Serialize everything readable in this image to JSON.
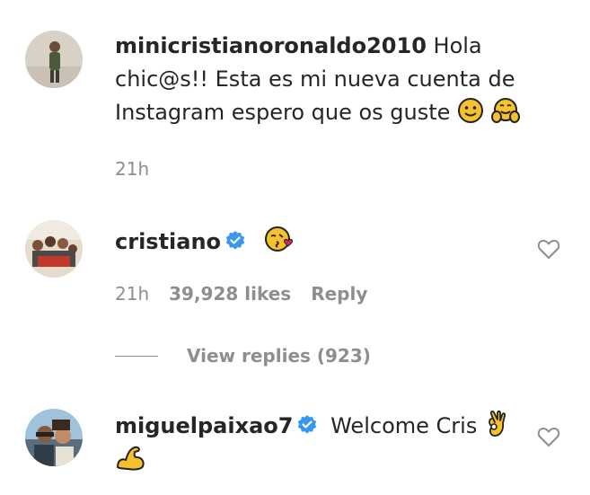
{
  "comments": [
    {
      "username": "minicristianoronaldo2010",
      "text_line1": "Hola",
      "text_line2": "chic@s!! Esta es mi nueva cuenta de",
      "text_line3": "Instagram espero que os guste",
      "emojis": [
        "slightly-smiling-face-emoji",
        "hugging-face-emoji"
      ],
      "time": "21h"
    },
    {
      "username": "cristiano",
      "verified": true,
      "emojis": [
        "face-blowing-kiss-emoji"
      ],
      "time": "21h",
      "likes": "39,928 likes",
      "reply_label": "Reply"
    },
    {
      "username": "miguelpaixao7",
      "verified": true,
      "text": "Welcome Cris",
      "emojis": [
        "ok-hand-emoji",
        "flexed-biceps-emoji"
      ]
    }
  ],
  "view_replies": "View replies (923)",
  "colors": {
    "text": "#262626",
    "muted": "#8e8e8e",
    "verified": "#3897f0",
    "emoji_yellow": "#f7c02d"
  }
}
